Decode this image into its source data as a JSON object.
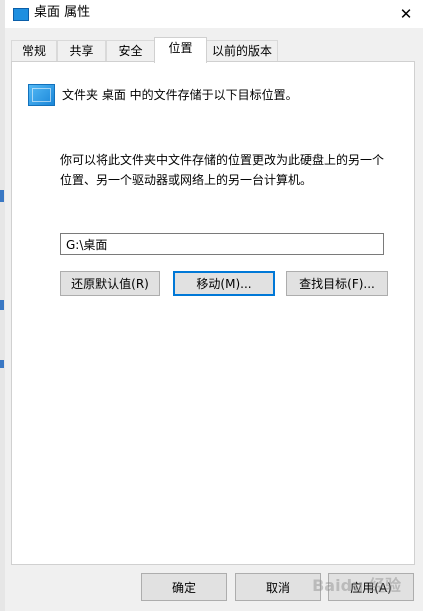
{
  "window": {
    "title": "桌面 属性",
    "icon": "folder-icon",
    "close_label": "✕"
  },
  "tabs": [
    {
      "label": "常规",
      "active": false
    },
    {
      "label": "共享",
      "active": false
    },
    {
      "label": "安全",
      "active": false
    },
    {
      "label": "位置",
      "active": true
    },
    {
      "label": "以前的版本",
      "active": false
    }
  ],
  "location_tab": {
    "header_text": "文件夹 桌面 中的文件存储于以下目标位置。",
    "description_line1": "你可以将此文件夹中文件存储的位置更改为此硬盘上的另一个",
    "description_line2": "位置、另一个驱动器或网络上的另一台计算机。",
    "path_value": "G:\\桌面",
    "restore_default_label": "还原默认值(R)",
    "move_label": "移动(M)...",
    "find_target_label": "查找目标(F)..."
  },
  "footer": {
    "ok_label": "确定",
    "cancel_label": "取消",
    "apply_label": "应用(A)"
  },
  "watermark": "Baidu 经验",
  "colors": {
    "accent": "#0078d7",
    "folder_icon": "#1e8fe0",
    "panel_bg": "#ffffff",
    "dialog_bg": "#f0f0f0"
  }
}
